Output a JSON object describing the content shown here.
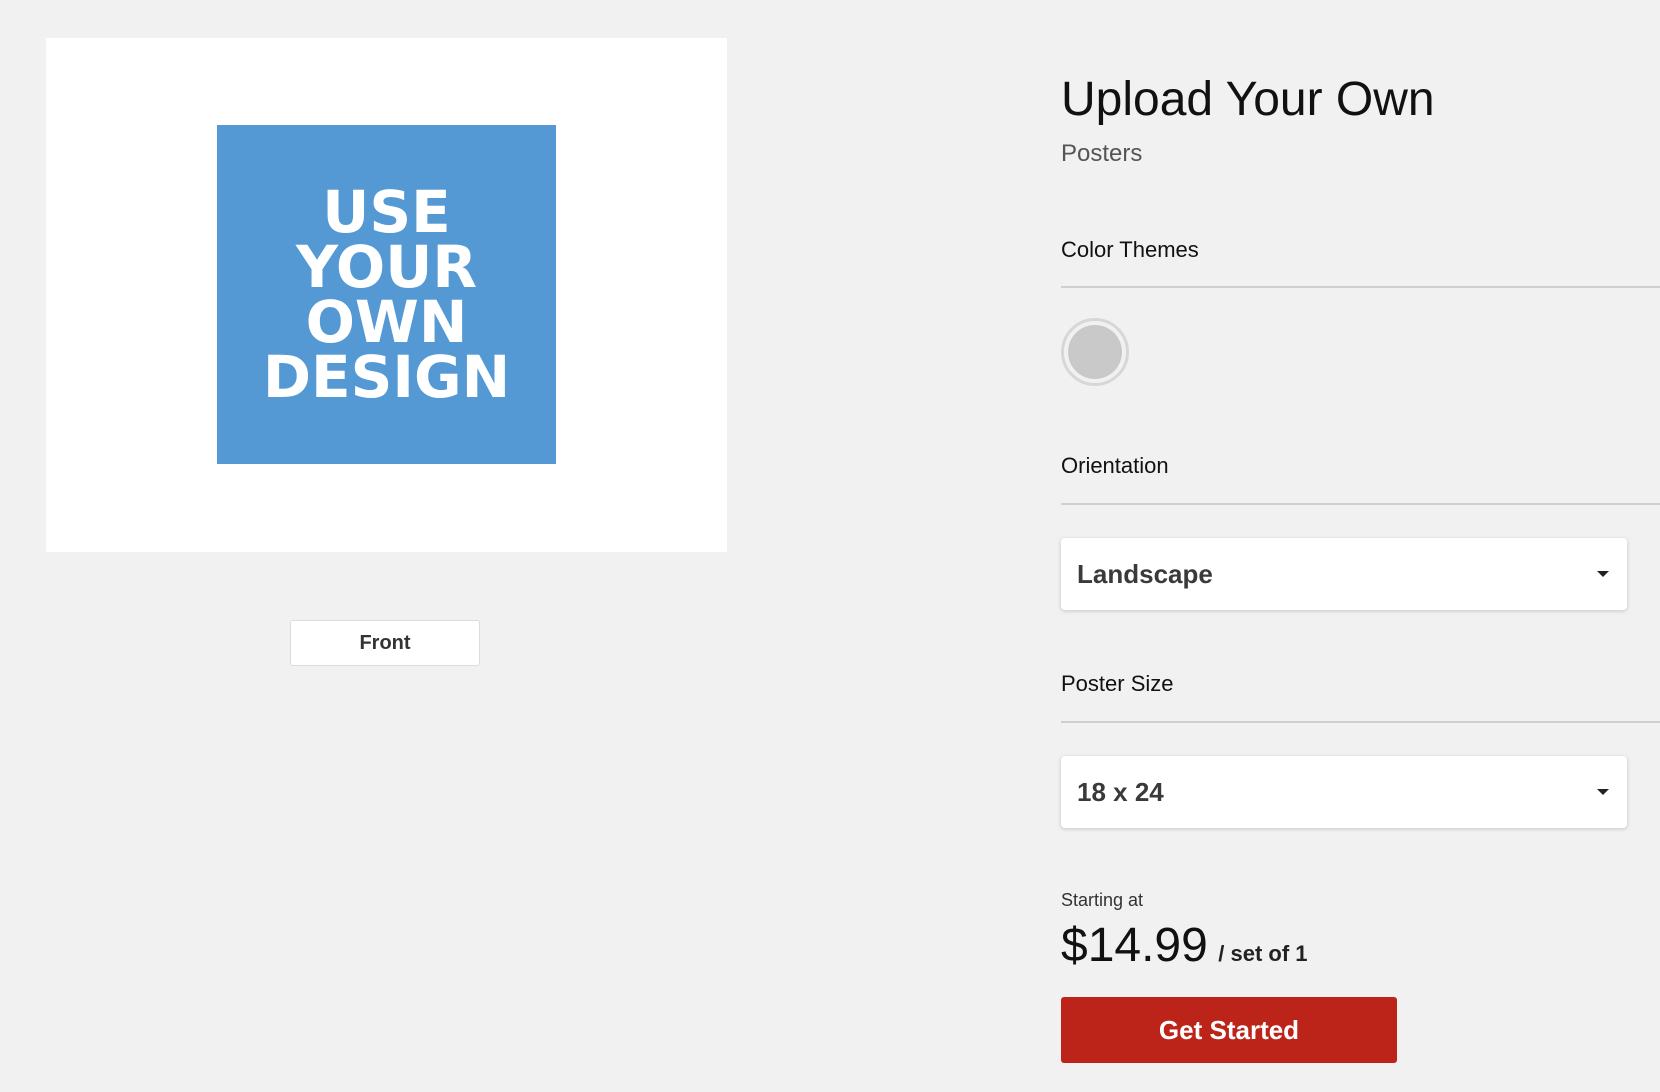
{
  "preview": {
    "design_lines": [
      "USE",
      "YOUR",
      "OWN",
      "DESIGN"
    ],
    "tile_color": "#5499d4",
    "view_tab_label": "Front"
  },
  "product": {
    "title": "Upload Your Own",
    "category": "Posters"
  },
  "color_themes": {
    "label": "Color Themes",
    "swatches": [
      {
        "color": "#c9c9c9",
        "selected": true
      }
    ]
  },
  "orientation": {
    "label": "Orientation",
    "selected": "Landscape"
  },
  "poster_size": {
    "label": "Poster Size",
    "selected": "18 x 24"
  },
  "pricing": {
    "caption": "Starting at",
    "amount": "$14.99",
    "unit": "/ set of 1"
  },
  "cta": {
    "label": "Get Started",
    "color": "#bd2419"
  },
  "icons": {
    "dropdown_caret": "caret-down-icon"
  }
}
